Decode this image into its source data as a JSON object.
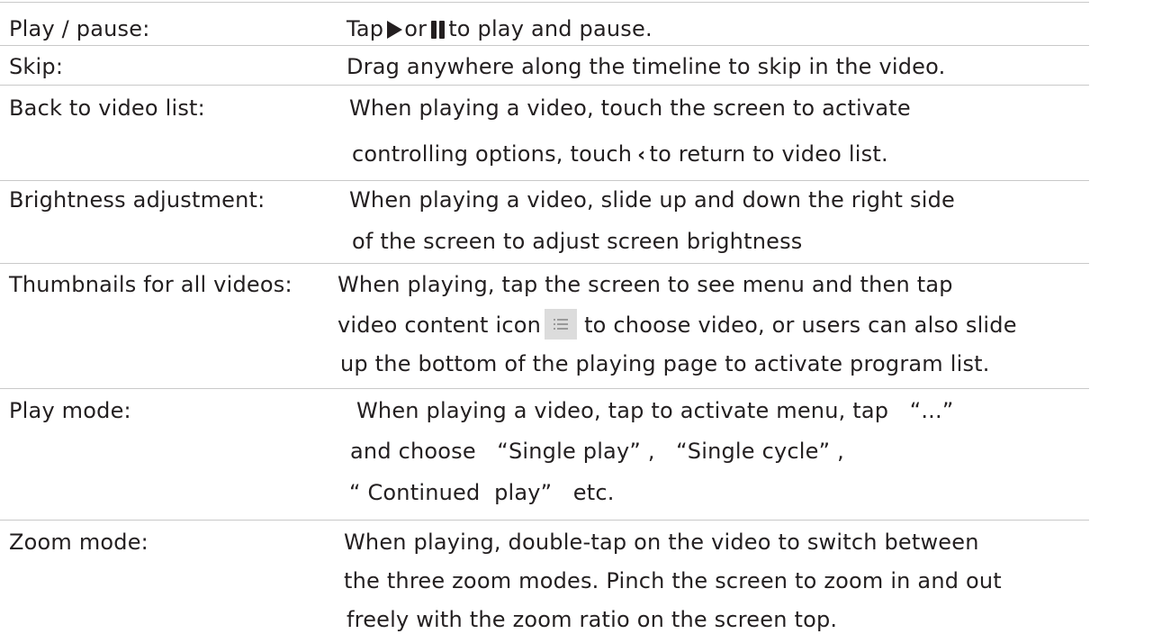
{
  "rows": [
    {
      "label": "Play / pause:",
      "lines": [
        {
          "pre": "Tap",
          "mid": "or",
          "post": "to play and pause.",
          "icons": [
            "play-icon",
            "pause-icon"
          ]
        }
      ]
    },
    {
      "label": "Skip:",
      "lines": [
        "Drag anywhere along the timeline to skip in the video."
      ]
    },
    {
      "label": "Back to video list:",
      "lines": [
        "When playing a video, touch the screen to activate",
        {
          "pre": "controlling options, touch",
          "post": "to return to video list.",
          "icon": "back-chevron-icon",
          "glyph": "‹"
        }
      ]
    },
    {
      "label": "Brightness adjustment:",
      "lines": [
        "When playing a video, slide up and down the right side",
        "of the screen to adjust screen brightness"
      ]
    },
    {
      "label": "Thumbnails for all videos:",
      "lines": [
        "When playing, tap the screen to see menu and then tap",
        {
          "pre": "video content icon",
          "post": "to choose video, or users can also slide",
          "icon": "list-icon"
        },
        "up the bottom of the playing page to activate program list."
      ]
    },
    {
      "label": "Play mode:",
      "lines": [
        "When playing a video, tap to activate menu, tap   “...”",
        "and choose   “Single play” ,   “Single cycle” ,",
        "“ Continued  play”   etc."
      ]
    },
    {
      "label": "Zoom mode:",
      "lines": [
        "When playing, double-tap on the video to switch between",
        "the three zoom modes. Pinch the screen to zoom in and out",
        "freely with the zoom ratio on the screen top."
      ]
    }
  ],
  "colors": {
    "text": "#231f20",
    "rule": "#c9c9c9",
    "icon_bg": "#dcdcdc"
  }
}
